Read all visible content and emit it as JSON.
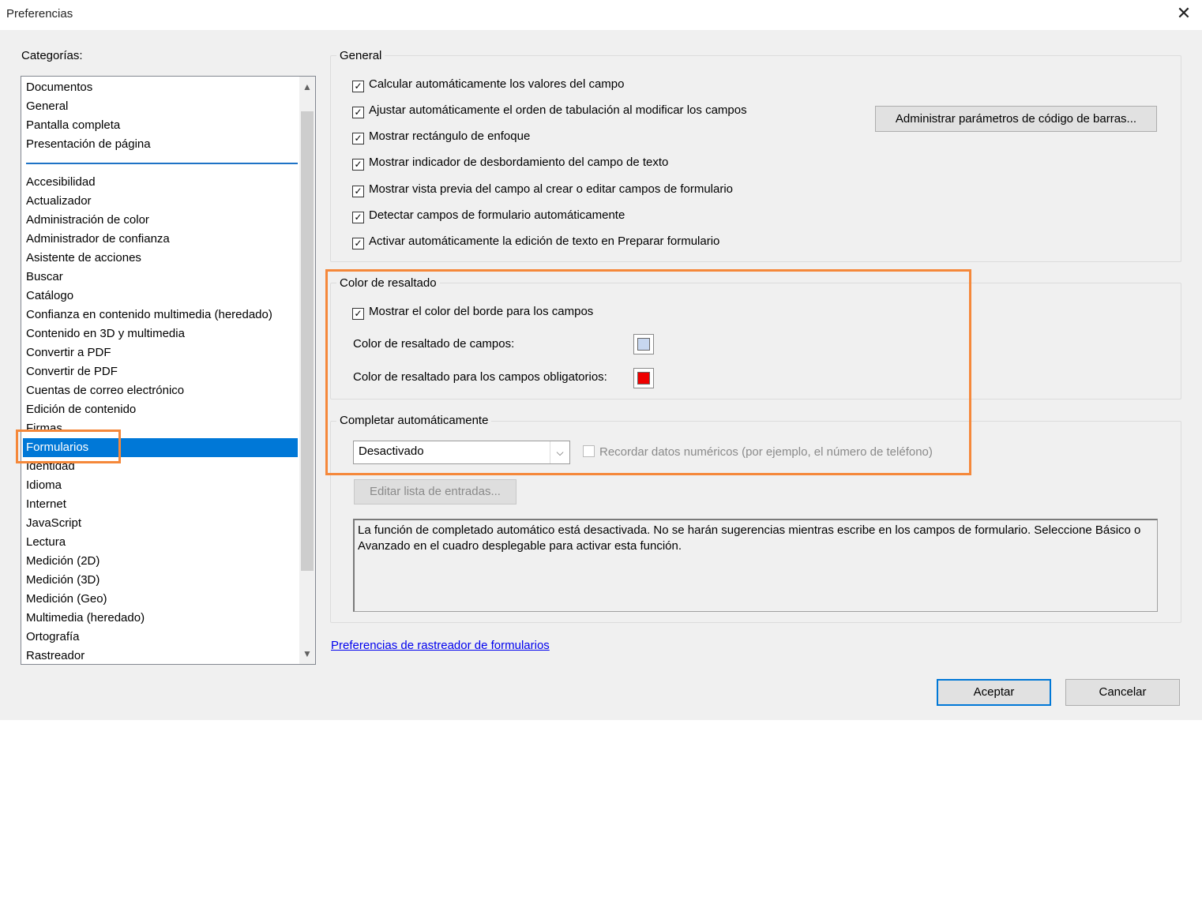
{
  "window": {
    "title": "Preferencias",
    "close_glyph": "✕"
  },
  "categories": {
    "label": "Categorías:",
    "top_items": [
      "Documentos",
      "General",
      "Pantalla completa",
      "Presentación de página"
    ],
    "items": [
      "Accesibilidad",
      "Actualizador",
      "Administración de color",
      "Administrador de confianza",
      "Asistente de acciones",
      "Buscar",
      "Catálogo",
      "Confianza en contenido multimedia (heredado)",
      "Contenido en 3D y multimedia",
      "Convertir a PDF",
      "Convertir de PDF",
      "Cuentas de correo electrónico",
      "Edición de contenido",
      "Firmas",
      "Formularios",
      "Identidad",
      "Idioma",
      "Internet",
      "JavaScript",
      "Lectura",
      "Medición (2D)",
      "Medición (3D)",
      "Medición (Geo)",
      "Multimedia (heredado)",
      "Ortografía",
      "Rastreador"
    ],
    "selected": "Formularios"
  },
  "general": {
    "legend": "General",
    "options": [
      {
        "label": "Calcular automáticamente los valores del campo",
        "checked": true
      },
      {
        "label": "Ajustar automáticamente el orden de tabulación al modificar los campos",
        "checked": true
      },
      {
        "label": "Mostrar rectángulo de enfoque",
        "checked": true
      },
      {
        "label": "Mostrar indicador de desbordamiento del campo de texto",
        "checked": true
      },
      {
        "label": "Mostrar vista previa del campo al crear o editar campos de formulario",
        "checked": true
      },
      {
        "label": "Detectar campos de formulario automáticamente",
        "checked": true
      },
      {
        "label": "Activar automáticamente la edición de texto en Preparar formulario",
        "checked": true
      }
    ],
    "barcode_button": "Administrar parámetros de código de barras..."
  },
  "highlight": {
    "legend": "Color de resaltado",
    "show_border": {
      "label": "Mostrar el color del borde para los campos",
      "checked": true
    },
    "field_color_label": "Color de resaltado de campos:",
    "field_color": "#c7d7ef",
    "required_color_label": "Color de resaltado para los campos obligatorios:",
    "required_color": "#ee0000"
  },
  "autocomplete": {
    "legend": "Completar automáticamente",
    "mode": "Desactivado",
    "remember_numeric": {
      "label": "Recordar datos numéricos (por ejemplo, el número de teléfono)",
      "checked": false
    },
    "edit_list_button": "Editar lista de entradas...",
    "description": "La función de completado automático está desactivada. No se harán sugerencias mientras escribe en los campos de formulario. Seleccione Básico o Avanzado en el cuadro desplegable para activar esta función."
  },
  "tracker_link": "Preferencias de rastreador de formularios",
  "footer": {
    "ok": "Aceptar",
    "cancel": "Cancelar"
  },
  "annotation_color": "#f5883a"
}
